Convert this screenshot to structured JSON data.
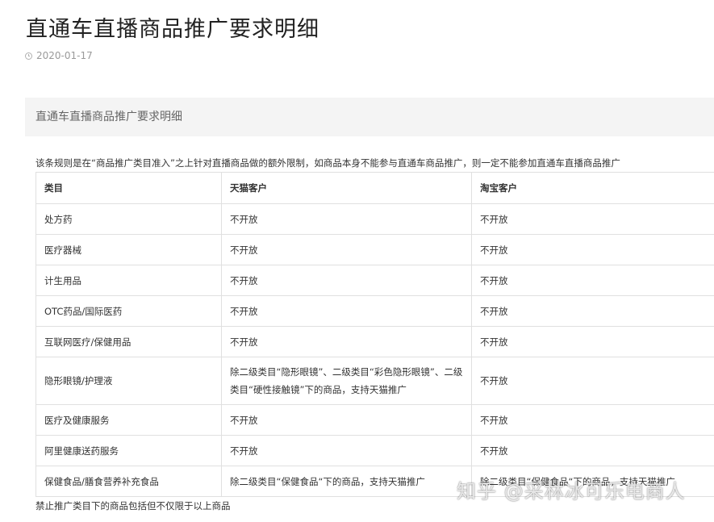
{
  "article": {
    "title": "直通车直播商品推广要求明细",
    "date": "2020-01-17",
    "section_header": "直通车直播商品推广要求明细",
    "intro": "该条规则是在“商品推广类目准入”之上针对直播商品做的额外限制，如商品本身不能参与直通车商品推广，则一定不能参加直通车直播商品推广",
    "footer_note": "禁止推广类目下的商品包括但不仅限于以上商品",
    "watermark": "知乎 @采林冰可乐电商人"
  },
  "table": {
    "headers": [
      "类目",
      "天猫客户",
      "淘宝客户"
    ],
    "rows": [
      [
        "处方药",
        "不开放",
        "不开放"
      ],
      [
        "医疗器械",
        "不开放",
        "不开放"
      ],
      [
        "计生用品",
        "不开放",
        "不开放"
      ],
      [
        "OTC药品/国际医药",
        "不开放",
        "不开放"
      ],
      [
        "互联网医疗/保健用品",
        "不开放",
        "不开放"
      ],
      [
        "隐形眼镜/护理液",
        "除二级类目“隐形眼镜”、二级类目“彩色隐形眼镜”、二级类目“硬性接触镜”下的商品，支持天猫推广",
        "不开放"
      ],
      [
        "医疗及健康服务",
        "不开放",
        "不开放"
      ],
      [
        "阿里健康送药服务",
        "不开放",
        "不开放"
      ],
      [
        "保健食品/膳食营养补充食品",
        "除二级类目“保健食品“下的商品，支持天猫推广",
        "除二级类目“保健食品“下的商品，支持天猫推广"
      ]
    ]
  },
  "icons": {
    "date_icon": "clock-icon"
  }
}
